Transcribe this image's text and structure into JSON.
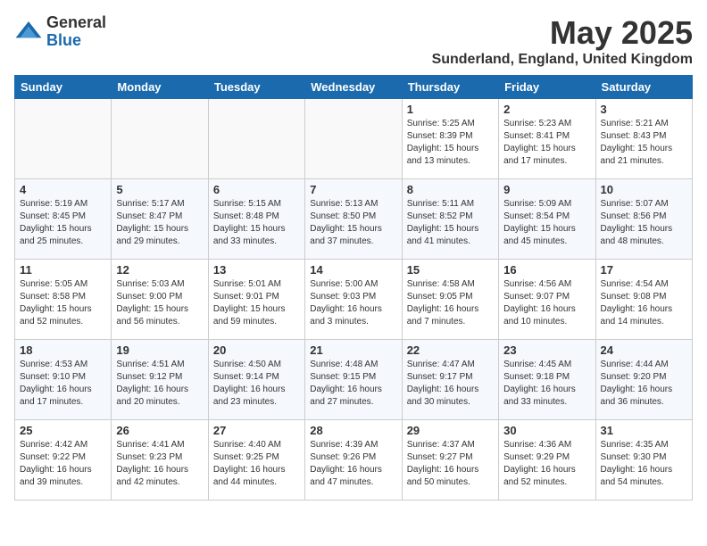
{
  "header": {
    "logo_general": "General",
    "logo_blue": "Blue",
    "title": "May 2025",
    "subtitle": "Sunderland, England, United Kingdom"
  },
  "weekdays": [
    "Sunday",
    "Monday",
    "Tuesday",
    "Wednesday",
    "Thursday",
    "Friday",
    "Saturday"
  ],
  "rows": [
    [
      {
        "day": "",
        "info": ""
      },
      {
        "day": "",
        "info": ""
      },
      {
        "day": "",
        "info": ""
      },
      {
        "day": "",
        "info": ""
      },
      {
        "day": "1",
        "info": "Sunrise: 5:25 AM\nSunset: 8:39 PM\nDaylight: 15 hours\nand 13 minutes."
      },
      {
        "day": "2",
        "info": "Sunrise: 5:23 AM\nSunset: 8:41 PM\nDaylight: 15 hours\nand 17 minutes."
      },
      {
        "day": "3",
        "info": "Sunrise: 5:21 AM\nSunset: 8:43 PM\nDaylight: 15 hours\nand 21 minutes."
      }
    ],
    [
      {
        "day": "4",
        "info": "Sunrise: 5:19 AM\nSunset: 8:45 PM\nDaylight: 15 hours\nand 25 minutes."
      },
      {
        "day": "5",
        "info": "Sunrise: 5:17 AM\nSunset: 8:47 PM\nDaylight: 15 hours\nand 29 minutes."
      },
      {
        "day": "6",
        "info": "Sunrise: 5:15 AM\nSunset: 8:48 PM\nDaylight: 15 hours\nand 33 minutes."
      },
      {
        "day": "7",
        "info": "Sunrise: 5:13 AM\nSunset: 8:50 PM\nDaylight: 15 hours\nand 37 minutes."
      },
      {
        "day": "8",
        "info": "Sunrise: 5:11 AM\nSunset: 8:52 PM\nDaylight: 15 hours\nand 41 minutes."
      },
      {
        "day": "9",
        "info": "Sunrise: 5:09 AM\nSunset: 8:54 PM\nDaylight: 15 hours\nand 45 minutes."
      },
      {
        "day": "10",
        "info": "Sunrise: 5:07 AM\nSunset: 8:56 PM\nDaylight: 15 hours\nand 48 minutes."
      }
    ],
    [
      {
        "day": "11",
        "info": "Sunrise: 5:05 AM\nSunset: 8:58 PM\nDaylight: 15 hours\nand 52 minutes."
      },
      {
        "day": "12",
        "info": "Sunrise: 5:03 AM\nSunset: 9:00 PM\nDaylight: 15 hours\nand 56 minutes."
      },
      {
        "day": "13",
        "info": "Sunrise: 5:01 AM\nSunset: 9:01 PM\nDaylight: 15 hours\nand 59 minutes."
      },
      {
        "day": "14",
        "info": "Sunrise: 5:00 AM\nSunset: 9:03 PM\nDaylight: 16 hours\nand 3 minutes."
      },
      {
        "day": "15",
        "info": "Sunrise: 4:58 AM\nSunset: 9:05 PM\nDaylight: 16 hours\nand 7 minutes."
      },
      {
        "day": "16",
        "info": "Sunrise: 4:56 AM\nSunset: 9:07 PM\nDaylight: 16 hours\nand 10 minutes."
      },
      {
        "day": "17",
        "info": "Sunrise: 4:54 AM\nSunset: 9:08 PM\nDaylight: 16 hours\nand 14 minutes."
      }
    ],
    [
      {
        "day": "18",
        "info": "Sunrise: 4:53 AM\nSunset: 9:10 PM\nDaylight: 16 hours\nand 17 minutes."
      },
      {
        "day": "19",
        "info": "Sunrise: 4:51 AM\nSunset: 9:12 PM\nDaylight: 16 hours\nand 20 minutes."
      },
      {
        "day": "20",
        "info": "Sunrise: 4:50 AM\nSunset: 9:14 PM\nDaylight: 16 hours\nand 23 minutes."
      },
      {
        "day": "21",
        "info": "Sunrise: 4:48 AM\nSunset: 9:15 PM\nDaylight: 16 hours\nand 27 minutes."
      },
      {
        "day": "22",
        "info": "Sunrise: 4:47 AM\nSunset: 9:17 PM\nDaylight: 16 hours\nand 30 minutes."
      },
      {
        "day": "23",
        "info": "Sunrise: 4:45 AM\nSunset: 9:18 PM\nDaylight: 16 hours\nand 33 minutes."
      },
      {
        "day": "24",
        "info": "Sunrise: 4:44 AM\nSunset: 9:20 PM\nDaylight: 16 hours\nand 36 minutes."
      }
    ],
    [
      {
        "day": "25",
        "info": "Sunrise: 4:42 AM\nSunset: 9:22 PM\nDaylight: 16 hours\nand 39 minutes."
      },
      {
        "day": "26",
        "info": "Sunrise: 4:41 AM\nSunset: 9:23 PM\nDaylight: 16 hours\nand 42 minutes."
      },
      {
        "day": "27",
        "info": "Sunrise: 4:40 AM\nSunset: 9:25 PM\nDaylight: 16 hours\nand 44 minutes."
      },
      {
        "day": "28",
        "info": "Sunrise: 4:39 AM\nSunset: 9:26 PM\nDaylight: 16 hours\nand 47 minutes."
      },
      {
        "day": "29",
        "info": "Sunrise: 4:37 AM\nSunset: 9:27 PM\nDaylight: 16 hours\nand 50 minutes."
      },
      {
        "day": "30",
        "info": "Sunrise: 4:36 AM\nSunset: 9:29 PM\nDaylight: 16 hours\nand 52 minutes."
      },
      {
        "day": "31",
        "info": "Sunrise: 4:35 AM\nSunset: 9:30 PM\nDaylight: 16 hours\nand 54 minutes."
      }
    ]
  ]
}
